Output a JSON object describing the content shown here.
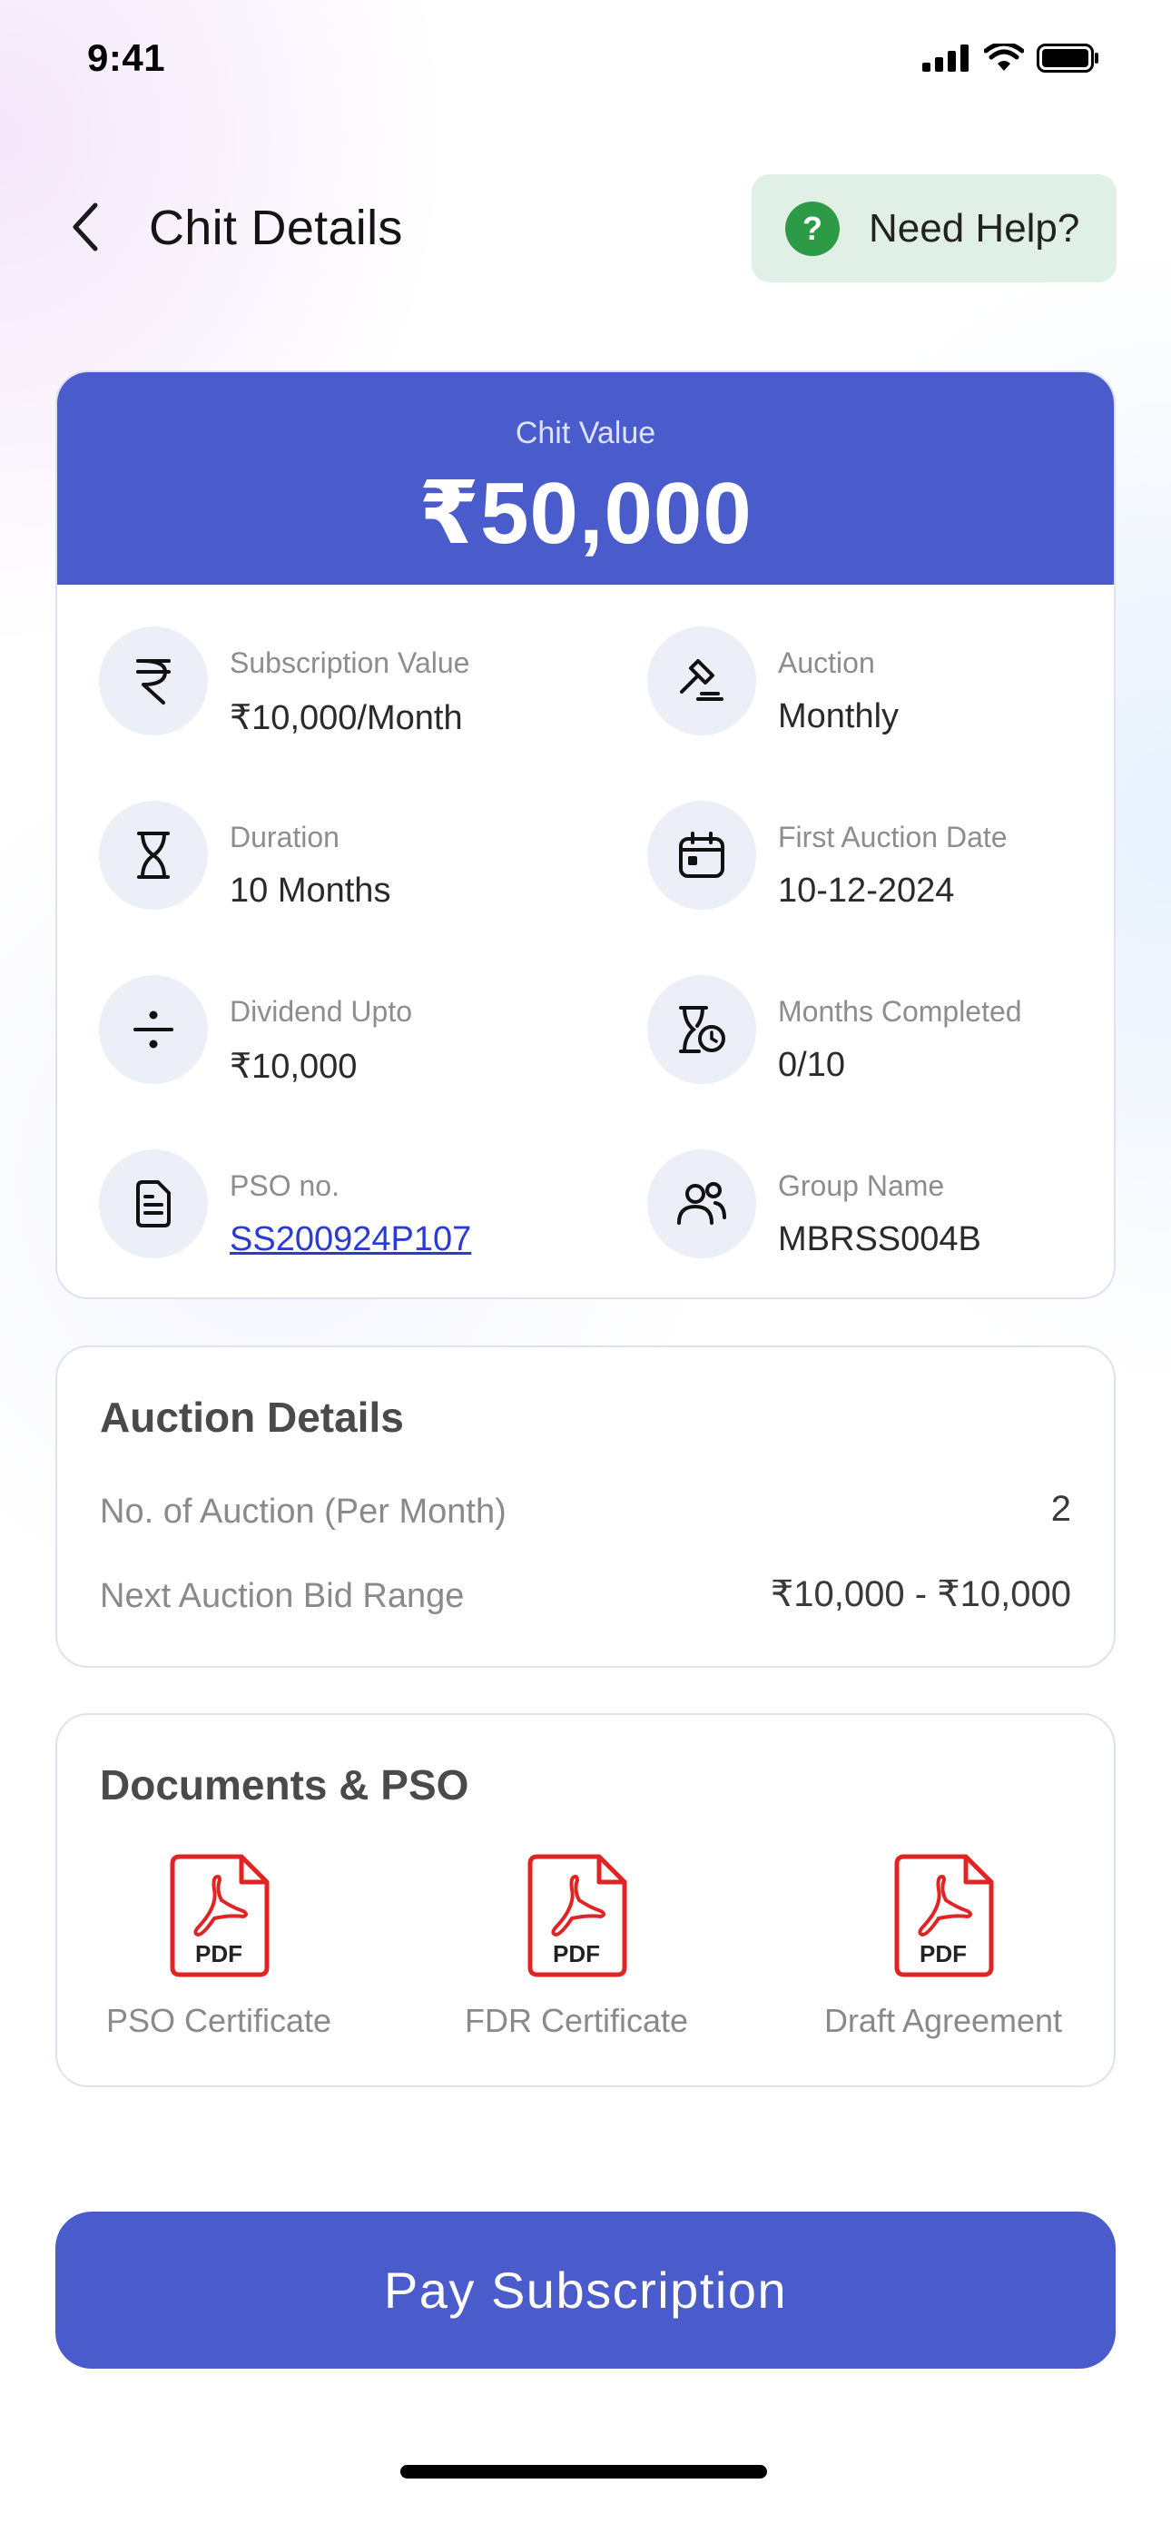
{
  "status_bar": {
    "time": "9:41"
  },
  "header": {
    "title": "Chit Details",
    "help_label": "Need Help?",
    "help_glyph": "?"
  },
  "chit": {
    "label": "Chit Value",
    "value": "₹50,000",
    "details": [
      {
        "label": "Subscription Value",
        "value": "₹10,000/Month",
        "icon": "rupee-icon"
      },
      {
        "label": "Auction",
        "value": "Monthly",
        "icon": "gavel-icon"
      },
      {
        "label": "Duration",
        "value": "10 Months",
        "icon": "hourglass-icon"
      },
      {
        "label": "First Auction Date",
        "value": "10-12-2024",
        "icon": "calendar-icon"
      },
      {
        "label": "Dividend Upto",
        "value": "₹10,000",
        "icon": "divide-icon"
      },
      {
        "label": "Months Completed",
        "value": "0/10",
        "icon": "hourglass-clock-icon"
      },
      {
        "label": "PSO no.",
        "value": "SS200924P107",
        "icon": "document-icon"
      },
      {
        "label": "Group Name",
        "value": "MBRSS004B",
        "icon": "group-icon"
      }
    ]
  },
  "auction_details": {
    "title": "Auction Details",
    "rows": [
      {
        "label": "No. of Auction (Per Month)",
        "value": "2"
      },
      {
        "label": "Next Auction Bid Range",
        "value": "₹10,000 - ₹10,000"
      }
    ]
  },
  "documents": {
    "title": "Documents & PSO",
    "pdf_tag": "PDF",
    "items": [
      {
        "label": "PSO Certificate"
      },
      {
        "label": "FDR Certificate"
      },
      {
        "label": "Draft Agreement"
      }
    ]
  },
  "pay_button": {
    "label": "Pay Subscription"
  },
  "colors": {
    "primary": "#4a5ccb",
    "help_bg": "#e1f0e6",
    "help_icon": "#2d9a46",
    "pdf_red": "#e02424",
    "link": "#2a3bd1"
  }
}
